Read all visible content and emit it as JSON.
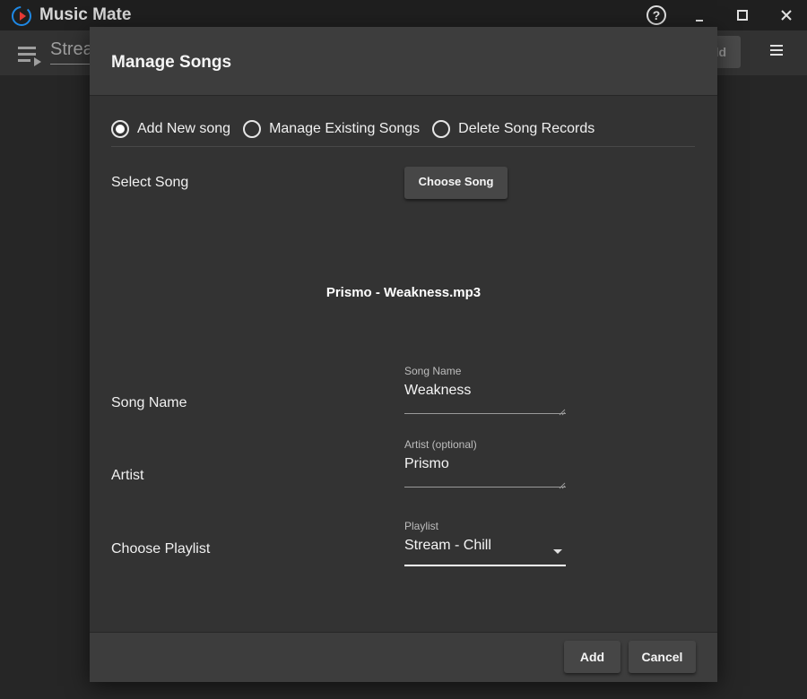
{
  "window": {
    "title": "Music Mate",
    "controls": [
      "help-icon",
      "minimize-icon",
      "maximize-icon",
      "close-icon"
    ]
  },
  "background": {
    "playlist_text": "Stream - Chill",
    "button_label": "Add Playlist"
  },
  "dialog": {
    "title": "Manage Songs",
    "modes": [
      {
        "label": "Add New song",
        "selected": true
      },
      {
        "label": "Manage Existing Songs",
        "selected": false
      },
      {
        "label": "Delete Song Records",
        "selected": false
      }
    ],
    "select_song": {
      "label": "Select Song",
      "button": "Choose Song"
    },
    "selected_file": "Prismo - Weakness.mp3",
    "song_name": {
      "label": "Song Name",
      "caption": "Song Name",
      "value": "Weakness"
    },
    "artist": {
      "label": "Artist",
      "caption": "Artist (optional)",
      "value": "Prismo"
    },
    "playlist": {
      "label": "Choose Playlist",
      "caption": "Playlist",
      "value": "Stream - Chill"
    },
    "footer": {
      "add": "Add",
      "cancel": "Cancel"
    }
  }
}
